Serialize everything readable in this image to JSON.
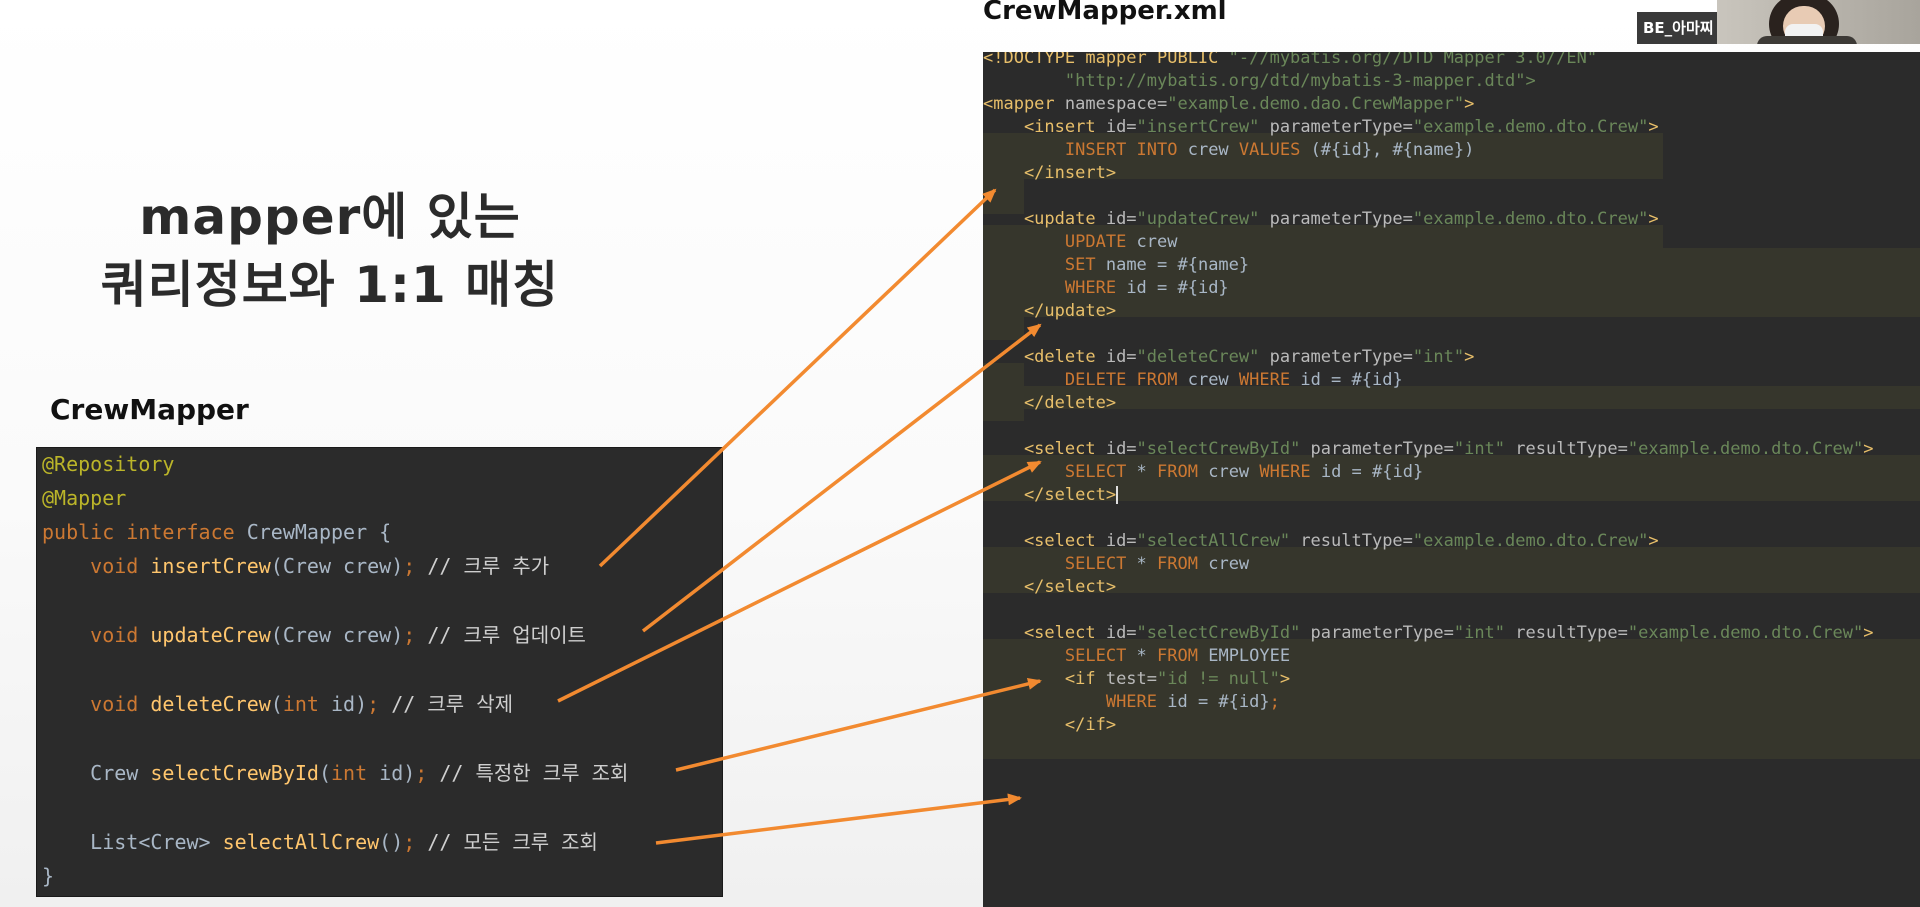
{
  "heading": {
    "line1": "mapper에 있는",
    "line2": "쿼리정보와 1:1 매칭"
  },
  "java_file_title": "CrewMapper",
  "xml_file_title": "CrewMapper.xml",
  "participant_name": "BE_아마찌",
  "java_code": {
    "line1": "@Repository",
    "line2": "@Mapper",
    "line3_kw": "public interface",
    "line3_rest": " CrewMapper {",
    "methods": [
      {
        "ret": "    void ",
        "name": "insertCrew",
        "params": "(Crew crew)",
        "semi": ";",
        "comment": " // 크루 추가"
      },
      {
        "ret": "    void ",
        "name": "updateCrew",
        "params": "(Crew crew)",
        "semi": ";",
        "comment": " // 크루 업데이트"
      },
      {
        "ret": "    void ",
        "name": "deleteCrew",
        "params_kw": "int",
        "params": " id)",
        "semi": ";",
        "comment": " // 크루 삭제"
      },
      {
        "ret": "    Crew ",
        "name": "selectCrewById",
        "params_kw": "int",
        "params": " id)",
        "semi": ";",
        "comment": " // 특정한 크루 조회"
      },
      {
        "ret": "    List<Crew> ",
        "name": "selectAllCrew",
        "params": "()",
        "semi": ";",
        "comment": " // 모든 크루 조회"
      }
    ],
    "close": "}"
  },
  "xml_code": {
    "doctype1": "<!DOCTYPE mapper PUBLIC ",
    "doctype1_str": "\"-//mybatis.org//DTD Mapper 3.0//EN\"",
    "doctype2_str": "        \"http://mybatis.org/dtd/mybatis-3-mapper.dtd\">",
    "mapper_open": "<mapper",
    "mapper_attr": " namespace=",
    "mapper_ns": "\"example.demo.dao.CrewMapper\"",
    "insert": {
      "open": "    <insert",
      "id": "\"insertCrew\"",
      "ptype": "\"example.demo.dto.Crew\"",
      "body_kw1": "INSERT INTO",
      "body_mid": " crew ",
      "body_kw2": "VALUES",
      "body_rest": " (#{id}, #{name})",
      "close": "    </insert>"
    },
    "update": {
      "open": "    <update",
      "id": "\"updateCrew\"",
      "ptype": "\"example.demo.dto.Crew\"",
      "l1_kw": "UPDATE",
      "l1_rest": " crew",
      "l2_kw": "SET",
      "l2_rest": " name = #{name}",
      "l3_kw": "WHERE",
      "l3_rest": " id = #{id}",
      "close": "    </update>"
    },
    "delete": {
      "open": "    <delete",
      "id": "\"deleteCrew\"",
      "ptype": "\"int\"",
      "kw1": "DELETE FROM",
      "mid": " crew ",
      "kw2": "WHERE",
      "rest": " id = #{id}",
      "close": "    </delete>"
    },
    "select_by_id": {
      "open": "    <select",
      "id": "\"selectCrewById\"",
      "ptype": "\"int\"",
      "rtype": "\"example.demo.dto.Crew\"",
      "kw1": "SELECT",
      "mid1": " * ",
      "kw2": "FROM",
      "mid2": " crew ",
      "kw3": "WHERE",
      "rest": " id = #{id}",
      "close": "    </select>"
    },
    "select_all": {
      "open": "    <select",
      "id": "\"selectAllCrew\"",
      "rtype": "\"example.demo.dto.Crew\"",
      "kw1": "SELECT",
      "mid1": " * ",
      "kw2": "FROM",
      "rest": " crew",
      "close": "    </select>"
    },
    "select_by_id2": {
      "open": "    <select",
      "id": "\"selectCrewById\"",
      "ptype": "\"int\"",
      "rtype": "\"example.demo.dto.Crew\"",
      "kw1": "SELECT",
      "mid1": " * ",
      "kw2": "FROM",
      "rest": " EMPLOYEE",
      "if_open": "        <if",
      "if_attr": " test=",
      "if_str": "\"id != null\"",
      "where_kw": "WHERE",
      "where_rest": " id = #{id}",
      "where_semi": ";",
      "if_close": "        </if>"
    },
    "attr_id": " id=",
    "attr_ptype": " parameterType=",
    "attr_rtype": " resultType=",
    "gt": ">",
    "body_indent": "        ",
    "where_indent": "            "
  },
  "arrow_color": "#f28a30"
}
